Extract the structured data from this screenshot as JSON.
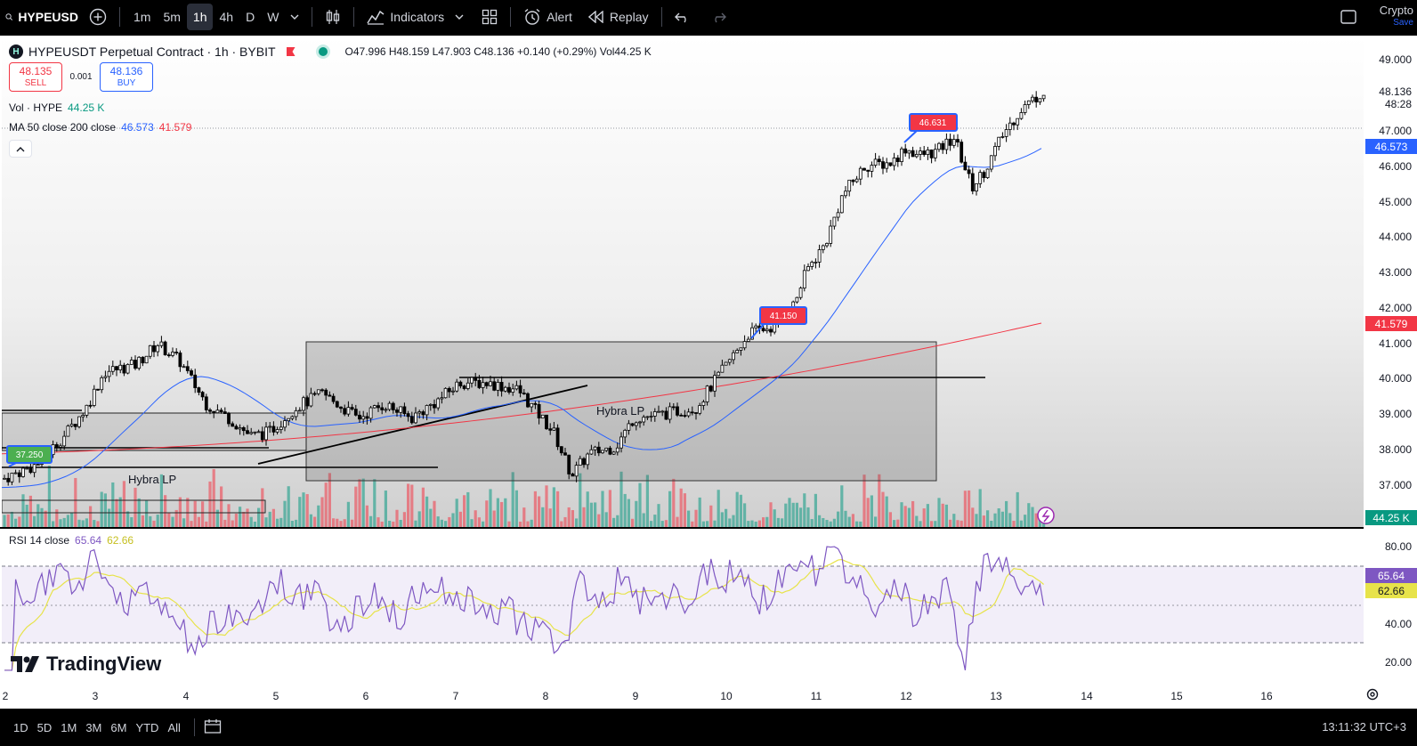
{
  "toolbar": {
    "symbol": "HYPEUSD",
    "intervals": [
      "1m",
      "5m",
      "1h",
      "4h",
      "D",
      "W"
    ],
    "active_interval": "1h",
    "indicators_label": "Indicators",
    "alert_label": "Alert",
    "replay_label": "Replay",
    "crypto_label": "Crypto",
    "save_label": "Save"
  },
  "legend": {
    "title": "HYPEUSDT Perpetual Contract · 1h · BYBIT",
    "ohlc": "O47.996 H48.159 L47.903 C48.136 +0.140 (+0.29%) Vol44.25 K",
    "sell_price": "48.135",
    "sell_label": "SELL",
    "spread": "0.001",
    "buy_price": "48.136",
    "buy_label": "BUY",
    "vol_label": "Vol · HYPE",
    "vol_value": "44.25 K",
    "ma_label": "MA 50 close 200 close",
    "ma50_value": "46.573",
    "ma200_value": "41.579"
  },
  "rsi": {
    "label": "RSI 14 close",
    "value": "65.64",
    "ma_value": "62.66"
  },
  "annotations": {
    "zone_label_1": "Hybra LP",
    "zone_label_2": "Hybra LP",
    "callout_1": "46.631",
    "callout_2": "41.150",
    "callout_3": "37.250"
  },
  "price_axis": {
    "labels": [
      "49.000",
      "47.000",
      "46.000",
      "45.000",
      "44.000",
      "43.000",
      "42.000",
      "41.000",
      "40.000",
      "39.000",
      "38.000",
      "37.000"
    ],
    "last_price": "48.136",
    "countdown": "48:28",
    "ma50_tag": "46.573",
    "ma200_tag": "41.579",
    "vol_tag": "44.25 K",
    "rsi_labels": [
      "80.00",
      "40.00",
      "20.00"
    ],
    "rsi_tag": "65.64",
    "rsi_ma_tag": "62.66"
  },
  "time_axis": {
    "labels": [
      "2",
      "3",
      "4",
      "5",
      "6",
      "7",
      "8",
      "9",
      "10",
      "11",
      "12",
      "13",
      "14",
      "15",
      "16"
    ]
  },
  "bottombar": {
    "ranges": [
      "1D",
      "5D",
      "1M",
      "3M",
      "6M",
      "YTD",
      "All"
    ],
    "clock": "13:11:32 UTC+3"
  },
  "brand": {
    "name": "TradingView"
  },
  "colors": {
    "up": "#089981",
    "down": "#f23645",
    "ma50": "#2962ff",
    "ma200": "#f23645",
    "rsi": "#7e57c2",
    "rsi_ma": "#e7e34a"
  }
}
